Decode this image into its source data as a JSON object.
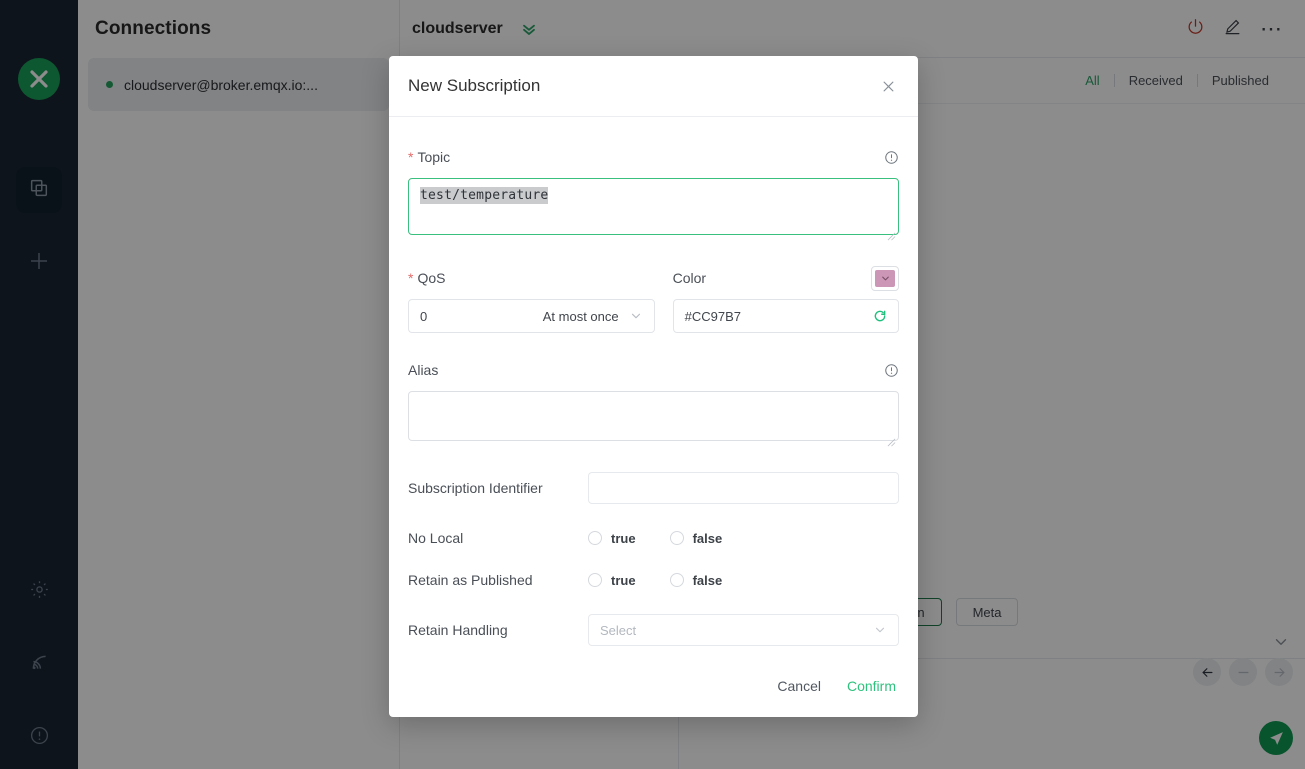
{
  "sidebar": {
    "logo_icon": "mqttx-logo-icon",
    "items": [
      {
        "name": "connections",
        "icon": "copy-stack-icon",
        "active": true
      },
      {
        "name": "new-connection",
        "icon": "plus-icon",
        "active": false
      },
      {
        "name": "settings",
        "icon": "gear-icon",
        "active": false
      },
      {
        "name": "logs",
        "icon": "rss-broadcast-icon",
        "active": false
      },
      {
        "name": "about",
        "icon": "exclamation-circle-icon",
        "active": false
      }
    ]
  },
  "connections_panel": {
    "title": "Connections",
    "items": [
      {
        "label": "cloudserver@broker.emqx.io:...",
        "status_color": "#26a25f"
      }
    ]
  },
  "main": {
    "title": "cloudserver",
    "expand_icon": "double-chevron-down-icon",
    "header_icons": [
      {
        "name": "power-icon",
        "color": "#c0392b"
      },
      {
        "name": "pencil-edit-icon",
        "color": "#3a3f46"
      },
      {
        "name": "more-dots-icon",
        "color": "#3a3f46"
      }
    ],
    "filters": [
      {
        "label": "All",
        "active": true
      },
      {
        "label": "Received",
        "active": false
      },
      {
        "label": "Published",
        "active": false
      }
    ],
    "tags": [
      {
        "label": "Retain",
        "highlighted": true
      },
      {
        "label": "Meta",
        "highlighted": false
      }
    ],
    "nav_buttons": [
      {
        "name": "prev-arrow-icon",
        "enabled": true
      },
      {
        "name": "minus-icon",
        "enabled": false
      },
      {
        "name": "next-arrow-icon",
        "enabled": false
      }
    ],
    "send_button_icon": "send-paper-plane-icon",
    "collapse_icon": "chevron-down-icon"
  },
  "modal": {
    "title": "New Subscription",
    "close_icon": "close-x-icon",
    "topic": {
      "label": "Topic",
      "required": true,
      "value": "test/temperature",
      "selected": true,
      "info_icon": "exclamation-circle-icon"
    },
    "qos": {
      "label": "QoS",
      "required": true,
      "value": "0",
      "value_text": "At most once",
      "dropdown_icon": "chevron-down-icon"
    },
    "color": {
      "label": "Color",
      "value": "#CC97B7",
      "swatch_color": "#CC97B7",
      "swatch_icon": "chevron-down-icon",
      "refresh_icon": "refresh-icon",
      "refresh_color": "#1fc07e"
    },
    "alias": {
      "label": "Alias",
      "value": "",
      "info_icon": "exclamation-circle-icon"
    },
    "subscription_identifier": {
      "label": "Subscription Identifier",
      "value": "",
      "placeholder": ""
    },
    "no_local": {
      "label": "No Local",
      "options": [
        {
          "label": "true",
          "selected": false
        },
        {
          "label": "false",
          "selected": false
        }
      ]
    },
    "retain_as_published": {
      "label": "Retain as Published",
      "options": [
        {
          "label": "true",
          "selected": false
        },
        {
          "label": "false",
          "selected": false
        }
      ]
    },
    "retain_handling": {
      "label": "Retain Handling",
      "placeholder": "Select",
      "value": "",
      "dropdown_icon": "chevron-down-icon"
    },
    "footer": {
      "cancel_label": "Cancel",
      "confirm_label": "Confirm",
      "confirm_color": "#2ec27e"
    }
  }
}
